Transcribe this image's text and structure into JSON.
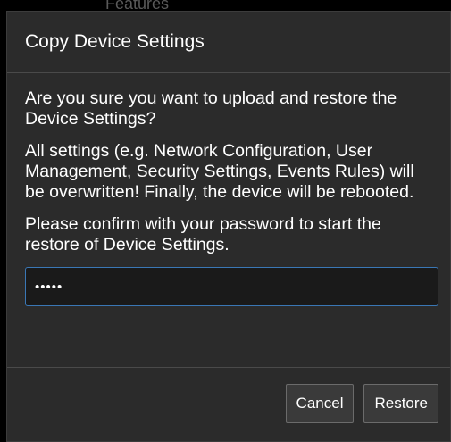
{
  "backdrop": {
    "partial_label": "Features"
  },
  "dialog": {
    "title": "Copy Device Settings",
    "question": "Are you sure you want to upload and restore the Device Settings?",
    "warning": "All settings (e.g. Network Configuration, User Management, Security Settings, Events Rules) will be overwritten! Finally, the device will be rebooted.",
    "confirm_prompt": "Please confirm with your password to start the restore of Device Settings.",
    "password_value": "•••••",
    "cancel_label": "Cancel",
    "restore_label": "Restore"
  },
  "colors": {
    "dialog_background": "#2b2b2b",
    "input_border_focus": "#3a77b5",
    "text": "#ffffff"
  }
}
